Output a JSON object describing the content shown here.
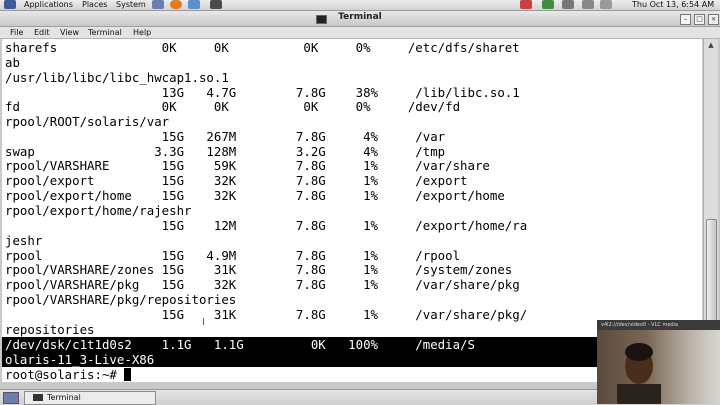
{
  "top_panel": {
    "applications": "Applications",
    "places": "Places",
    "system": "System",
    "clock": "Thu Oct 13,  6:54 AM"
  },
  "window": {
    "title": "Terminal"
  },
  "menubar": {
    "items": [
      "File",
      "Edit",
      "View",
      "Terminal",
      "Help"
    ]
  },
  "terminal": {
    "lines": [
      "sharefs              0K     0K          0K     0%     /etc/dfs/sharet",
      "ab",
      "/usr/lib/libc/libc_hwcap1.so.1",
      "                     13G   4.7G        7.8G    38%     /lib/libc.so.1",
      "fd                   0K     0K          0K     0%     /dev/fd",
      "rpool/ROOT/solaris/var",
      "                     15G   267M        7.8G     4%     /var",
      "swap                3.3G   128M        3.2G     4%     /tmp",
      "rpool/VARSHARE       15G    59K        7.8G     1%     /var/share",
      "rpool/export         15G    32K        7.8G     1%     /export",
      "rpool/export/home    15G    32K        7.8G     1%     /export/home",
      "rpool/export/home/rajeshr",
      "                     15G    12M        7.8G     1%     /export/home/ra",
      "jeshr",
      "rpool                15G   4.9M        7.8G     1%     /rpool",
      "rpool/VARSHARE/zones 15G    31K        7.8G     1%     /system/zones",
      "rpool/VARSHARE/pkg   15G    32K        7.8G     1%     /var/share/pkg",
      "rpool/VARSHARE/pkg/repositories",
      "                     15G    31K        7.8G     1%     /var/share/pkg/",
      "repositories",
      "/dev/dsk/c1t1d0s2    1.1G   1.1G         0K   100%     /media/S",
      "olaris-11_3-Live-X86"
    ],
    "prompt": "root@solaris:~# "
  },
  "taskbar": {
    "terminal_label": "Terminal"
  },
  "vlc_overlay": {
    "title": "v4l2:///dev/video0 - VLC media"
  }
}
